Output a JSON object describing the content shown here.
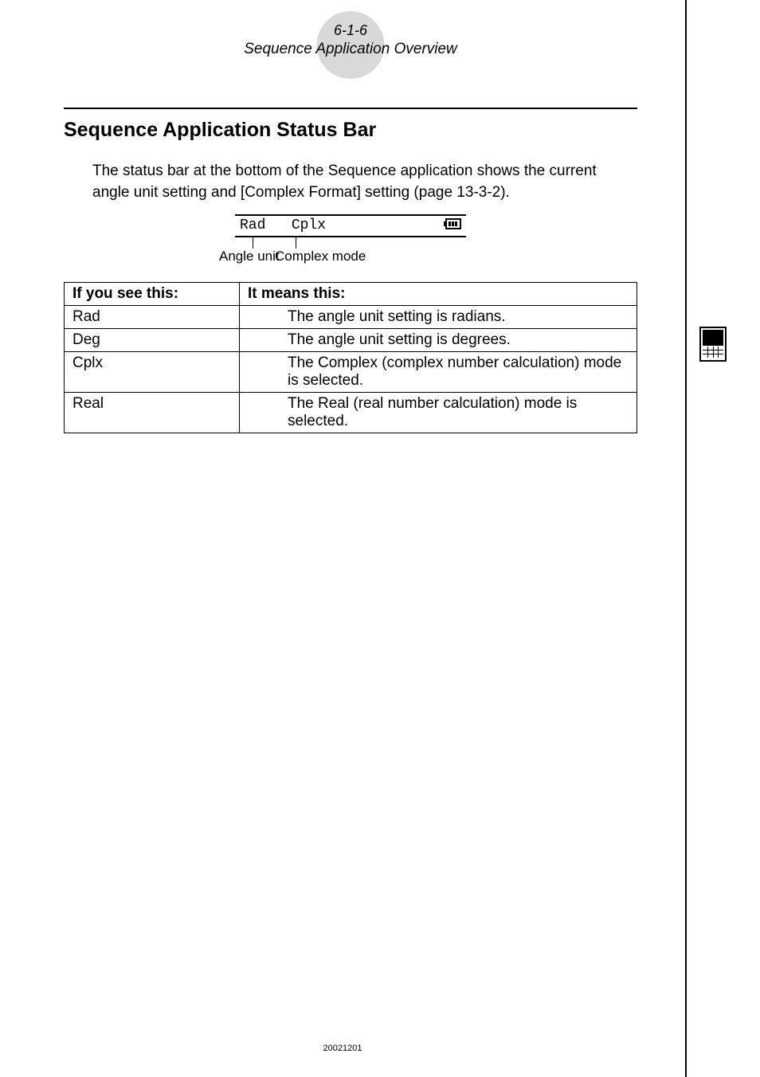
{
  "header": {
    "code": "6-1-6",
    "subtitle": "Sequence Application Overview"
  },
  "section_title": "Sequence Application Status Bar",
  "intro": "The status bar at the bottom of the Sequence application shows the current angle unit setting and [Complex Format] setting (page 13-3-2).",
  "statusbar": {
    "item1": "Rad",
    "item2": "Cplx",
    "callout1": "Angle unit",
    "callout2": "Complex mode"
  },
  "table": {
    "header_left": "If you see this:",
    "header_right": "It means this:",
    "rows": [
      {
        "left": "Rad",
        "right": "The angle unit setting is radians."
      },
      {
        "left": "Deg",
        "right": "The angle unit setting is degrees."
      },
      {
        "left": "Cplx",
        "right": "The Complex (complex number calculation) mode is selected."
      },
      {
        "left": "Real",
        "right": "The Real (real number calculation) mode is selected."
      }
    ]
  },
  "footer": "20021201"
}
